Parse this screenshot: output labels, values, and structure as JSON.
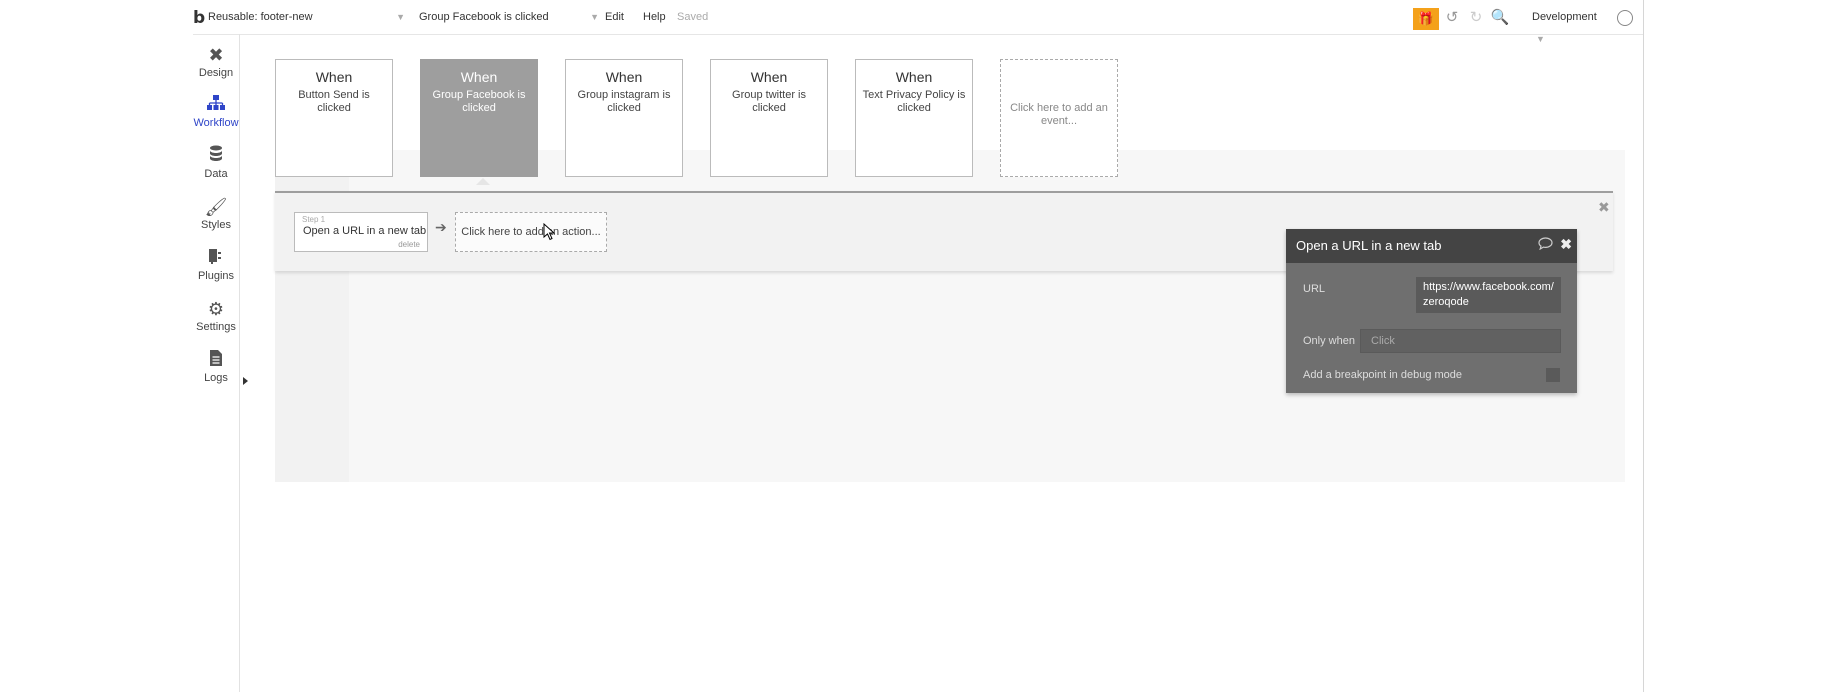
{
  "topbar": {
    "logo": "b",
    "page_selector": "Reusable: footer-new",
    "event_selector": "Group Facebook is clicked",
    "menu_edit": "Edit",
    "menu_help": "Help",
    "status": "Saved",
    "environment": "Development"
  },
  "sidebar": {
    "items": [
      {
        "label": "Design",
        "icon": "design-icon"
      },
      {
        "label": "Workflow",
        "icon": "workflow-icon"
      },
      {
        "label": "Data",
        "icon": "database-icon"
      },
      {
        "label": "Styles",
        "icon": "brush-icon"
      },
      {
        "label": "Plugins",
        "icon": "plug-icon"
      },
      {
        "label": "Settings",
        "icon": "gear-icon"
      },
      {
        "label": "Logs",
        "icon": "document-icon"
      }
    ]
  },
  "events": [
    {
      "when": "When",
      "desc": "Button Send is clicked"
    },
    {
      "when": "When",
      "desc": "Group Facebook is clicked"
    },
    {
      "when": "When",
      "desc": "Group instagram is clicked"
    },
    {
      "when": "When",
      "desc": "Group twitter is clicked"
    },
    {
      "when": "When",
      "desc": "Text Privacy Policy is clicked"
    }
  ],
  "add_event": "Click here to add an event...",
  "actions": {
    "step_label": "Step 1",
    "step_name": "Open a URL in a new tab",
    "delete_label": "delete",
    "add_action": "Click here to add an action..."
  },
  "editor": {
    "title": "Open a URL in a new tab",
    "url_label": "URL",
    "url_value": "https://www.facebook.com/zeroqode",
    "only_when_label": "Only when",
    "only_when_placeholder": "Click",
    "breakpoint_label": "Add a breakpoint in debug mode"
  },
  "colors": {
    "accent_workflow": "#2f45c8",
    "gift": "#f4a11a",
    "selected_event": "#9e9e9e"
  }
}
